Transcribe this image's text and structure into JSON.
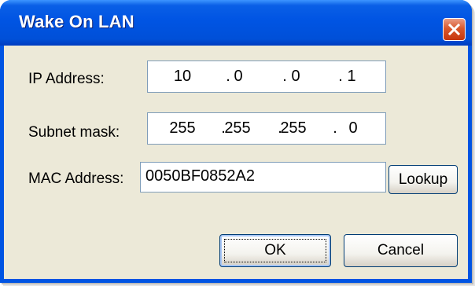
{
  "window": {
    "title": "Wake On LAN",
    "close_icon": "close-icon"
  },
  "fields": {
    "ip_label": "IP Address:",
    "ip_octets": [
      "10",
      "0",
      "0",
      "1"
    ],
    "subnet_label": "Subnet mask:",
    "subnet_octets": [
      "255",
      "255",
      "255",
      "0"
    ],
    "mac_label": "MAC Address:",
    "mac_value": "0050BF0852A2",
    "separator": "."
  },
  "buttons": {
    "lookup": "Lookup",
    "ok": "OK",
    "cancel": "Cancel"
  },
  "colors": {
    "titlebar": "#0054e3",
    "client": "#ece9d8",
    "close": "#c6360e"
  }
}
